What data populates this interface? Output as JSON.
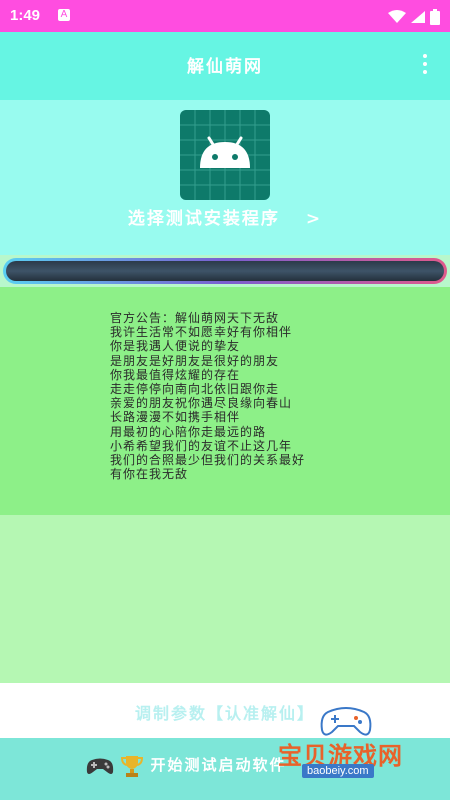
{
  "status_bar": {
    "time": "1:49",
    "notification_icon": "A"
  },
  "app_bar": {
    "title": "解仙萌网"
  },
  "hero": {
    "select_label": "选择测试安装程序",
    "select_arrow": ">"
  },
  "notice": {
    "lines": [
      "官方公告：解仙萌网天下无敌",
      "我许生活常不如愿幸好有你相伴",
      "你是我遇人便说的挚友",
      "是朋友是好朋友是很好的朋友",
      "你我最值得炫耀的存在",
      "走走停停向南向北依旧跟你走",
      "亲爱的朋友祝你遇尽良缘向春山",
      "长路漫漫不如携手相伴",
      "用最初的心陪你走最远的路",
      "小希希望我们的友谊不止这几年",
      "我们的合照最少但我们的关系最好",
      "有你在我无敌"
    ]
  },
  "param_bar": {
    "label": "调制参数【认准解仙】"
  },
  "start_bar": {
    "label": "开始测试启动软件"
  },
  "watermark": {
    "name": "宝贝游戏网",
    "url": "baobeiy.com"
  },
  "colors": {
    "status_bar": "#ff4de0",
    "app_bar": "#66f5e3",
    "hero": "#98fbef",
    "notice": "#8df088",
    "spacer": "#b5f7b3",
    "start_bar": "#7de6d8",
    "app_icon": "#0e7a6a"
  }
}
